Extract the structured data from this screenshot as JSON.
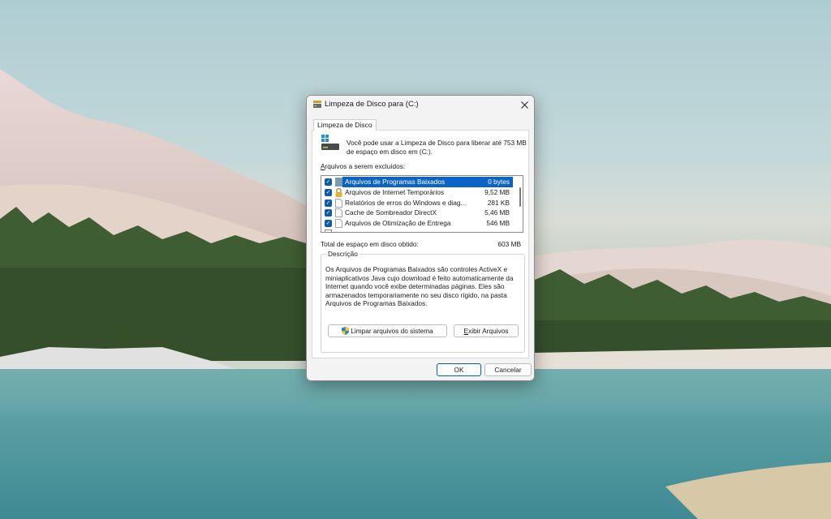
{
  "dialog": {
    "title": "Limpeza de Disco para  (C:)",
    "close_glyph": "✕",
    "tab_label": "Limpeza de Disco",
    "info_text": "Você pode usar a Limpeza de Disco para liberar até 753 MB de espaço em disco em  (C:).",
    "files_label_mnemonic": "A",
    "files_label_rest": "rquivos a serem excluídos:",
    "files": [
      {
        "name": "Arquivos de Programas Baixados",
        "size": "0 bytes",
        "checked": true,
        "selected": true,
        "icon": "folder-icon"
      },
      {
        "name": "Arquivos de Internet Temporários",
        "size": "9,52 MB",
        "checked": true,
        "selected": false,
        "icon": "lock-icon"
      },
      {
        "name": "Relatórios de erros do Windows e diag...",
        "size": "281 KB",
        "checked": true,
        "selected": false,
        "icon": "file-icon"
      },
      {
        "name": "Cache de Sombreador DirectX",
        "size": "5,46 MB",
        "checked": true,
        "selected": false,
        "icon": "file-icon"
      },
      {
        "name": "Arquivos de Otimização de Entrega",
        "size": "546 MB",
        "checked": true,
        "selected": false,
        "icon": "file-icon"
      }
    ],
    "check_glyph": "✓",
    "total_label": "Total de espaço em disco obtido:",
    "total_value": "603 MB",
    "description_label": "Descrição",
    "description_text": "Os Arquivos de Programas Baixados são controles ActiveX e miniaplicativos Java cujo download é feito automaticamente da Internet quando você exibe determinadas páginas. Eles são armazenados temporariamente no seu disco rígido, na pasta Arquivos de Programas Baixados.",
    "clean_system_button": "Limpar arquivos do sistema",
    "view_files_mnemonic": "E",
    "view_files_rest": "xibir Arquivos",
    "ok_button": "OK",
    "cancel_button": "Cancelar"
  },
  "colors": {
    "accent": "#0b5cad",
    "selection": "#0b63c5",
    "dialog_bg": "#f3f3f3"
  }
}
